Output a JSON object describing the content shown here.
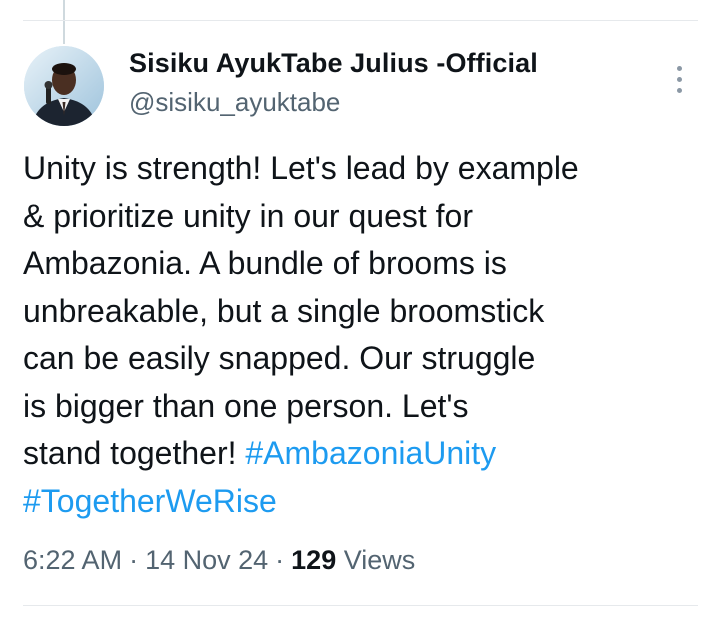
{
  "author": {
    "display_name": "Sisiku AyukTabe Julius -Official",
    "handle": "@sisiku_ayuktabe",
    "avatar_icon": "profile-photo"
  },
  "more_icon": "more-vertical-icon",
  "tweet": {
    "lines": [
      {
        "text": "Unity is strength! Let's lead by example"
      },
      {
        "text": "& prioritize unity in our quest for"
      },
      {
        "text": "Ambazonia. A bundle of brooms is"
      },
      {
        "text": "unbreakable, but a single broomstick"
      },
      {
        "text": "can be easily snapped. Our struggle"
      },
      {
        "text": "is bigger than one person. Let's"
      },
      {
        "text": "stand together! ",
        "hashtag": "#AmbazoniaUnity"
      },
      {
        "text": "",
        "hashtag": "#TogetherWeRise"
      }
    ]
  },
  "meta": {
    "time": "6:22 AM",
    "separator": "·",
    "date": "14 Nov 24",
    "views_count": "129",
    "views_label": " Views"
  },
  "colors": {
    "text": "#0f1419",
    "secondary": "#536471",
    "link": "#1d9bf0",
    "divider": "#e6e9ec"
  }
}
